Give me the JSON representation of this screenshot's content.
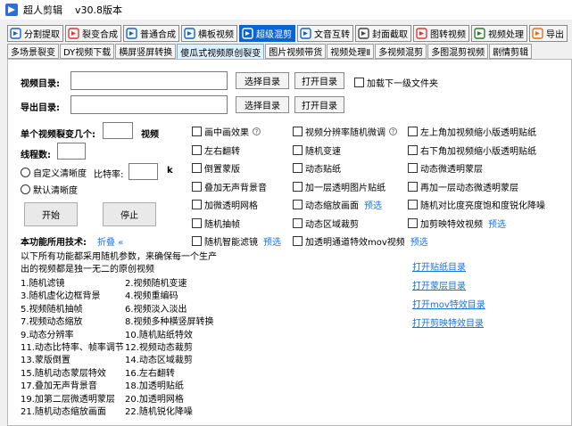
{
  "window": {
    "title": "超人剪辑",
    "version": "v30.8版本"
  },
  "tabs_top": [
    {
      "label": "分割提取",
      "icon": "split-icon",
      "active": false
    },
    {
      "label": "裂变合成",
      "icon": "compose-icon",
      "active": false
    },
    {
      "label": "普通合成",
      "icon": "play-icon",
      "active": false
    },
    {
      "label": "横板视频",
      "icon": "bookmark-icon",
      "active": false
    },
    {
      "label": "超级混剪",
      "icon": "film-icon",
      "active": true
    },
    {
      "label": "文音互转",
      "icon": "audio-icon",
      "active": false
    },
    {
      "label": "封面截取",
      "icon": "image-icon",
      "active": false
    },
    {
      "label": "图转视频",
      "icon": "slides-icon",
      "active": false
    },
    {
      "label": "视频处理",
      "icon": "video-icon",
      "active": false
    },
    {
      "label": "导出",
      "icon": "export-icon",
      "active": false
    }
  ],
  "tabs_sub": [
    "多场景裂变",
    "DY视频下载",
    "横屏竖屏转换",
    "傻瓜式视频原创裂变",
    "图片视频带货",
    "视频处理Ⅱ",
    "多视频混剪",
    "多图混剪视频",
    "剧情剪辑"
  ],
  "tabs_sub_active": 3,
  "form": {
    "video_dir_label": "视频目录:",
    "export_dir_label": "导出目录:",
    "select_dir": "选择目录",
    "open_dir": "打开目录",
    "load_subfolder": "加载下一级文件夹",
    "per_video_count_label": "单个视频裂变几个:",
    "per_video_unit": "视频",
    "threads_label": "线程数:",
    "custom_res": "自定义清晰度",
    "bitrate_label": "比特率:",
    "bitrate_unit": "k",
    "default_res": "默认清晰度",
    "start": "开始",
    "stop": "停止",
    "tech_label": "本功能所用技术:",
    "collapse": "折叠",
    "collapse_glyph": "«"
  },
  "options_col1": [
    {
      "label": "画中画效果",
      "help": "?",
      "preview": ""
    },
    {
      "label": "左右翻转",
      "help": "",
      "preview": ""
    },
    {
      "label": "倒置蒙版",
      "help": "",
      "preview": ""
    },
    {
      "label": "叠加无声背景音",
      "help": "",
      "preview": ""
    },
    {
      "label": "加微透明网格",
      "help": "",
      "preview": ""
    },
    {
      "label": "随机抽帧",
      "help": "",
      "preview": ""
    },
    {
      "label": "随机智能滤镜",
      "help": "",
      "preview": "预选"
    }
  ],
  "options_col2": [
    {
      "label": "视频分辨率随机微调",
      "help": "?",
      "preview": ""
    },
    {
      "label": "随机变速",
      "help": "",
      "preview": ""
    },
    {
      "label": "动态贴纸",
      "help": "",
      "preview": ""
    },
    {
      "label": "加一层透明图片贴纸",
      "help": "",
      "preview": ""
    },
    {
      "label": "动态缩放画面",
      "help": "",
      "preview": "预选"
    },
    {
      "label": "动态区域裁剪",
      "help": "",
      "preview": ""
    },
    {
      "label": "加透明通道特效mov视频",
      "help": "",
      "preview": "预选"
    }
  ],
  "options_col3": [
    {
      "label": "左上角加视频缩小版透明贴纸",
      "preview": ""
    },
    {
      "label": "右下角加视频缩小版透明贴纸",
      "preview": ""
    },
    {
      "label": "动态微透明蒙层",
      "preview": ""
    },
    {
      "label": "再加一层动态微透明蒙层",
      "preview": ""
    },
    {
      "label": "随机对比度亮度饱和度锐化降噪",
      "preview": ""
    },
    {
      "label": "加剪映特效视频",
      "preview": "预选"
    }
  ],
  "description": [
    "以下所有功能都采用随机参数，来确保每一个生产",
    "出的视频都是独一无二的原创视频"
  ],
  "features": [
    [
      "1.随机滤镜",
      "2.视频随机变速"
    ],
    [
      "3.随机虚化边框背景",
      "4.视频重编码"
    ],
    [
      "5.视频随机抽帧",
      "6.视频淡入淡出"
    ],
    [
      "7.视频动态缩放",
      "8.视频多种横竖屏转换"
    ],
    [
      "9.动态分辨率",
      "10.随机贴纸特效"
    ],
    [
      "11.动态比特率、帧率调节",
      "12.视频动态裁剪"
    ],
    [
      "13.蒙版倒置",
      "14.动态区域裁剪"
    ],
    [
      "15.随机动态蒙层特效",
      "16.左右翻转"
    ],
    [
      "17.叠加无声背景音",
      "18.加透明贴纸"
    ],
    [
      "19.加第二层微透明蒙层",
      "20.加透明网格"
    ],
    [
      "21.随机动态缩放画面",
      "22.随机锐化降噪"
    ]
  ],
  "dir_links": [
    "打开贴纸目录",
    "打开蒙层目录",
    "打开mov特效目录",
    "打开剪映特效目录"
  ]
}
